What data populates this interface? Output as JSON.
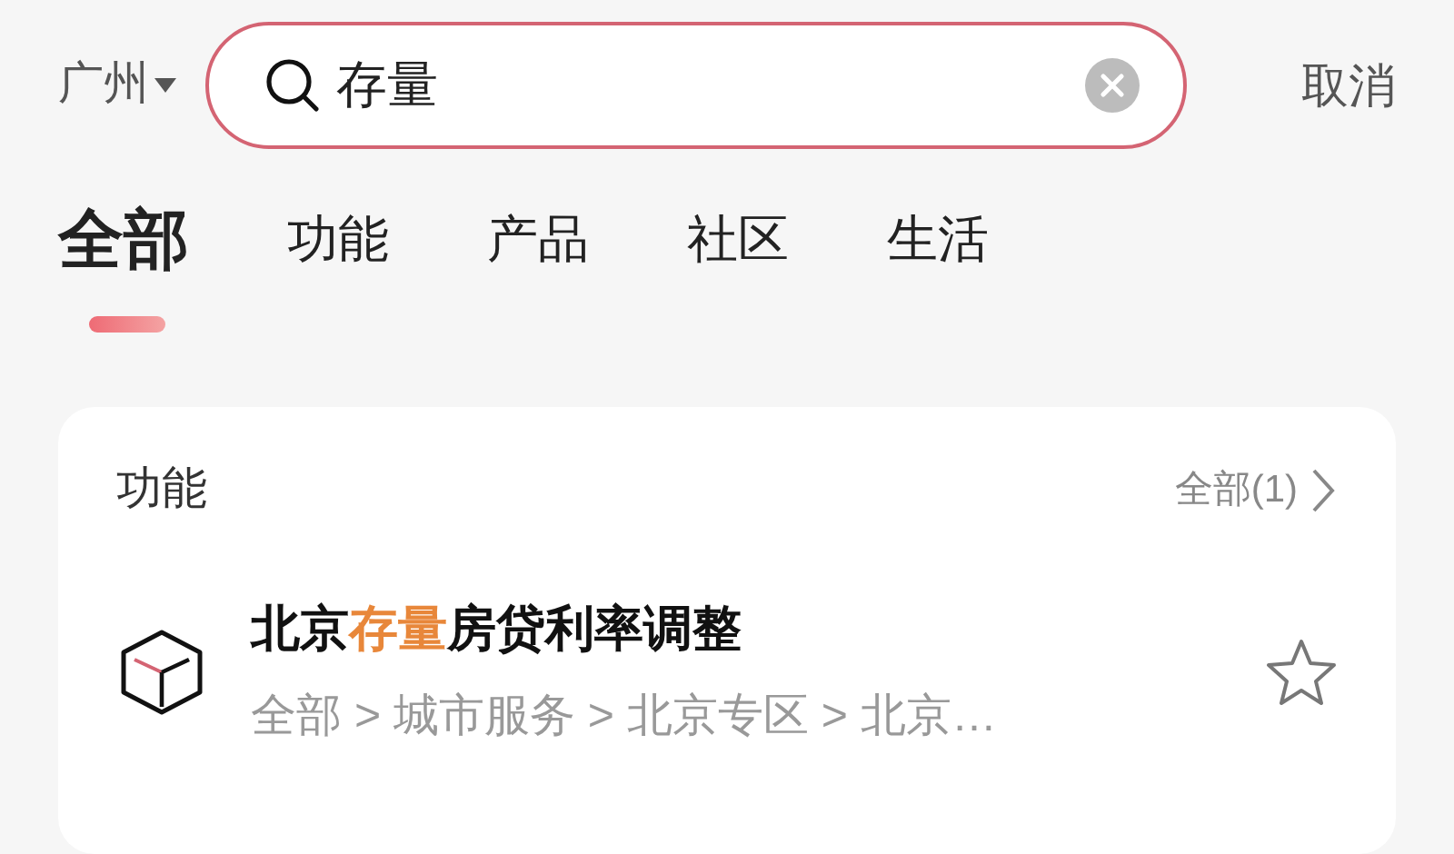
{
  "header": {
    "city": "广州",
    "search": {
      "value": "存量"
    },
    "cancel": "取消"
  },
  "tabs": [
    {
      "label": "全部",
      "selected": true
    },
    {
      "label": "功能",
      "selected": false
    },
    {
      "label": "产品",
      "selected": false
    },
    {
      "label": "社区",
      "selected": false
    },
    {
      "label": "生活",
      "selected": false
    }
  ],
  "section": {
    "title": "功能",
    "more": "全部(1)",
    "items": [
      {
        "title_parts": [
          {
            "text": "北京",
            "highlight": false
          },
          {
            "text": "存量",
            "highlight": true
          },
          {
            "text": "房贷利率调整",
            "highlight": false
          }
        ],
        "path": "全部 > 城市服务 > 北京专区 > 北京…",
        "starred": false
      }
    ]
  }
}
